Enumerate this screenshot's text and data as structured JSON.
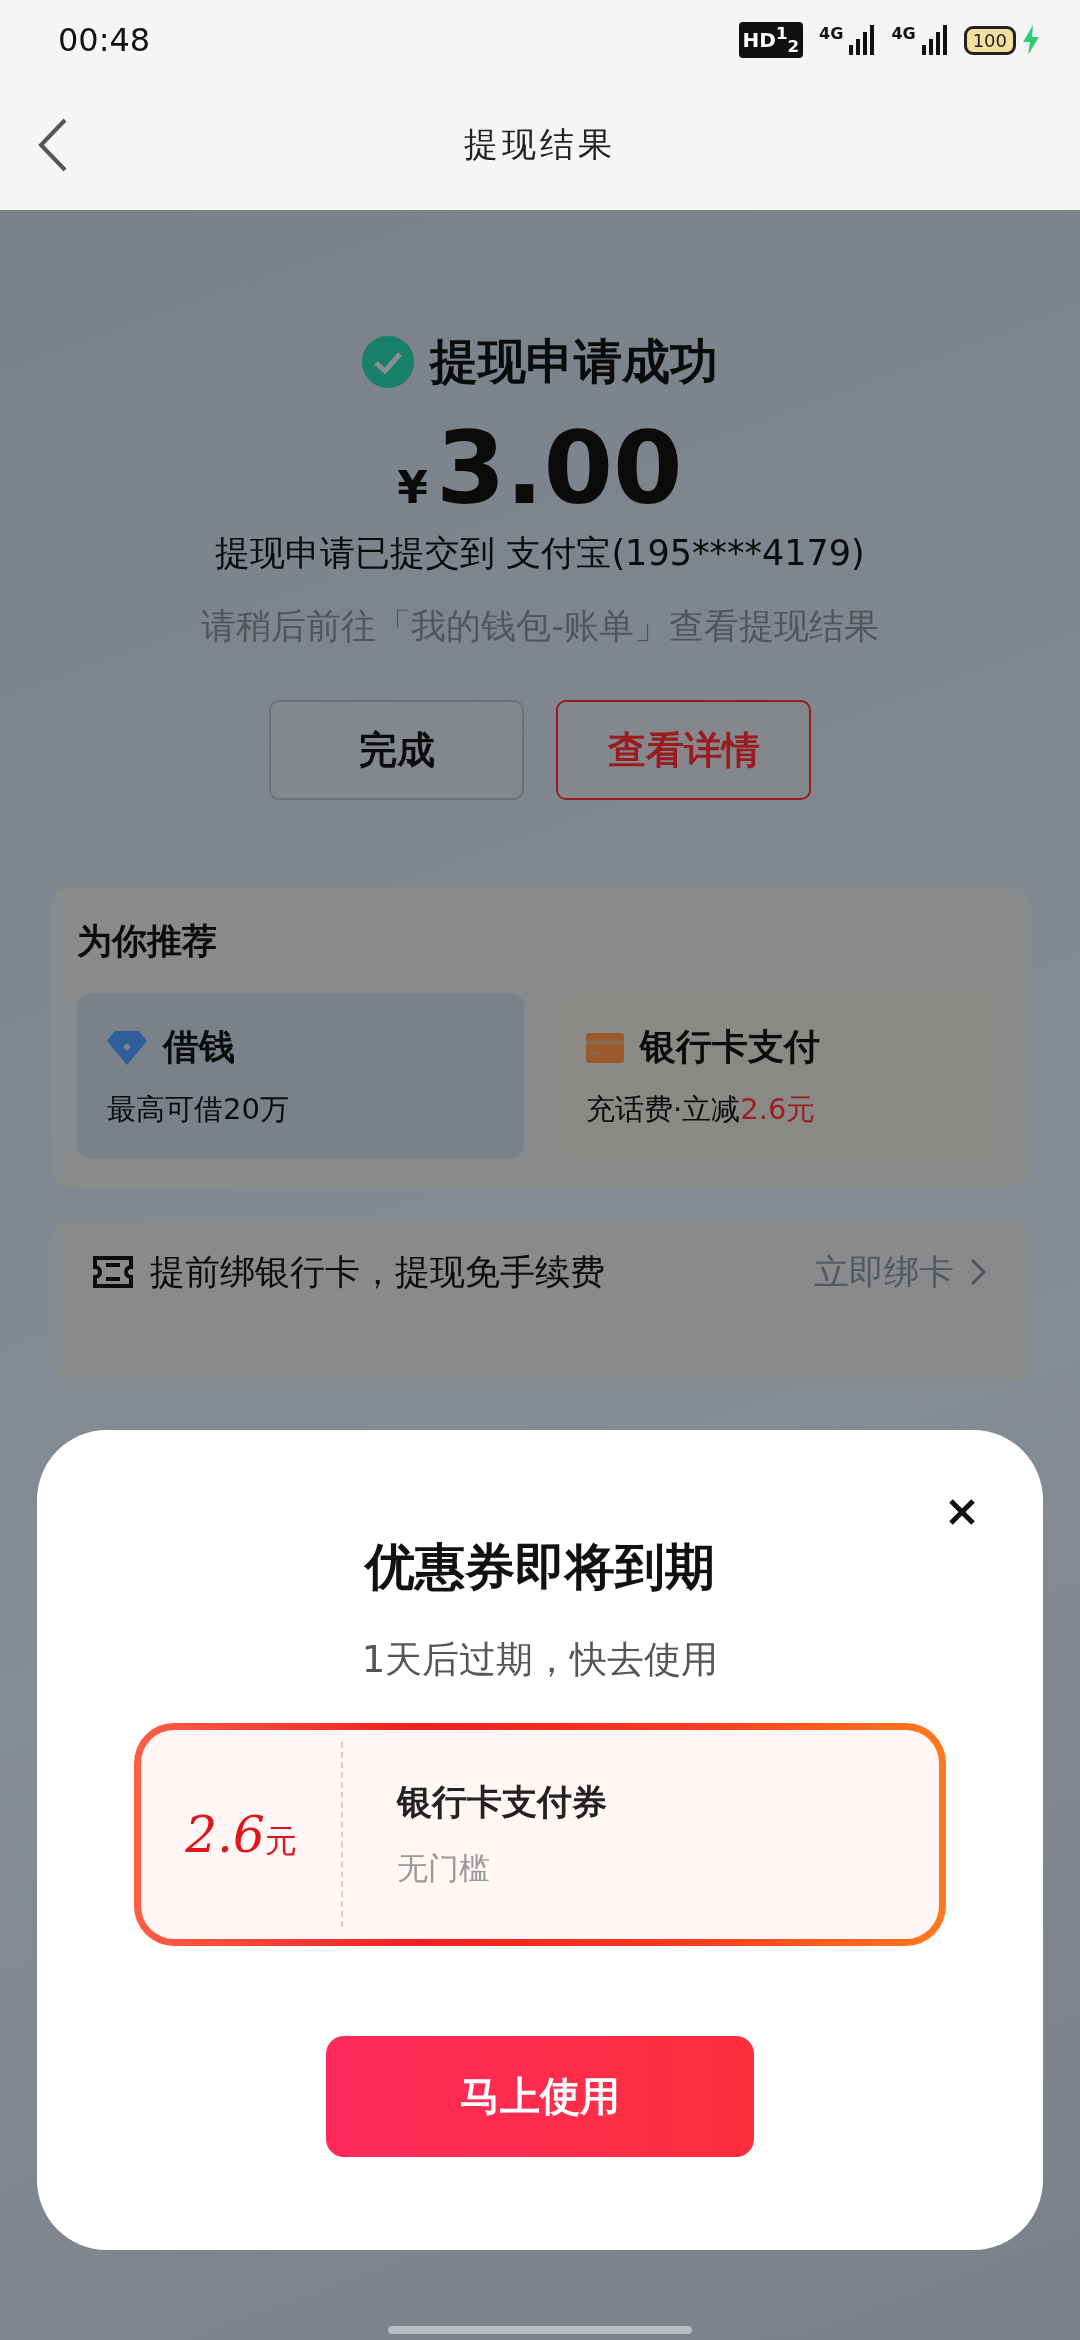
{
  "status_bar": {
    "time": "00:48",
    "hd": "HD$^{1}$$_{2}$",
    "networks": [
      "4G",
      "4G"
    ],
    "battery": "100"
  },
  "header": {
    "title": "提现结果"
  },
  "result": {
    "status": "提现申请成功",
    "currency": "¥",
    "amount": "3.00",
    "submitted": "提现申请已提交到 支付宝(195****4179)",
    "hint": "请稍后前往「我的钱包-账单」查看提现结果"
  },
  "buttons": [
    {
      "label": "完成",
      "kind": "plain"
    },
    {
      "label": "查看详情",
      "kind": "outline"
    }
  ],
  "recommend": {
    "title": "为你推荐",
    "items": [
      {
        "kind": "loan",
        "title": "借钱",
        "subtitle": "最高可借20万"
      },
      {
        "kind": "card",
        "title": "银行卡支付",
        "subtitle": "充话费·立减",
        "highlight": "2.6元"
      }
    ]
  },
  "bind": {
    "text": "提前绑银行卡，提现免手续费",
    "action": "立即绑卡"
  },
  "dialog": {
    "title": "优惠券即将到期",
    "subtitle": "1天后过期，快去使用",
    "coupon": {
      "amount": "2.6",
      "unit": "元",
      "name": "银行卡支付券",
      "condition": "无门槛"
    },
    "button": "马上使用"
  }
}
